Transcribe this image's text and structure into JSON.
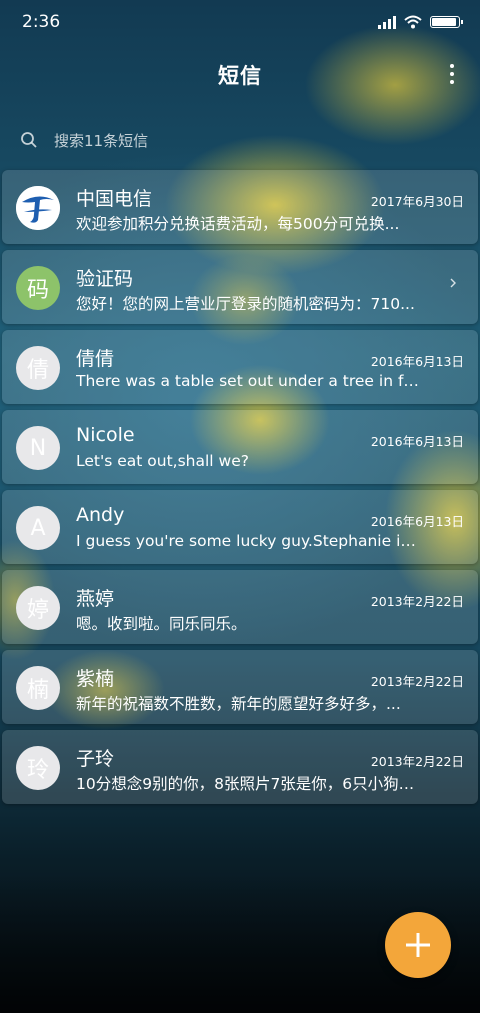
{
  "status": {
    "time": "2:36"
  },
  "header": {
    "title": "短信"
  },
  "search": {
    "placeholder": "搜索11条短信"
  },
  "colors": {
    "fab": "#f3a63a",
    "verify_avatar": "#8dc36a",
    "telecom_blue": "#1e5eb0"
  },
  "conversations": [
    {
      "avatar": "",
      "avatar_icon": "china-telecom-logo-icon",
      "name": "中国电信",
      "date": "2017年6月30日",
      "snippet": "欢迎参加积分兑换话费活动，每500分可兑换..."
    },
    {
      "avatar": "码",
      "name": "验证码",
      "date": "",
      "snippet": "您好！您的网上营业厅登录的随机密码为：710..."
    },
    {
      "avatar": "倩",
      "name": "倩倩",
      "date": "2016年6月13日",
      "snippet": "There was a table set out under a tree in fro..."
    },
    {
      "avatar": "N",
      "name": "Nicole",
      "date": "2016年6月13日",
      "snippet": "Let's eat out,shall we?"
    },
    {
      "avatar": "A",
      "name": "Andy",
      "date": "2016年6月13日",
      "snippet": "I guess you're some lucky guy.Stephanie is ..."
    },
    {
      "avatar": "婷",
      "name": "燕婷",
      "date": "2013年2月22日",
      "snippet": "嗯。收到啦。同乐同乐。"
    },
    {
      "avatar": "楠",
      "name": "紫楠",
      "date": "2013年2月22日",
      "snippet": "新年的祝福数不胜数，新年的愿望好多好多，..."
    },
    {
      "avatar": "玲",
      "name": "子玲",
      "date": "2013年2月22日",
      "snippet": "10分想念9别的你，8张照片7张是你，6只小狗5..."
    }
  ]
}
